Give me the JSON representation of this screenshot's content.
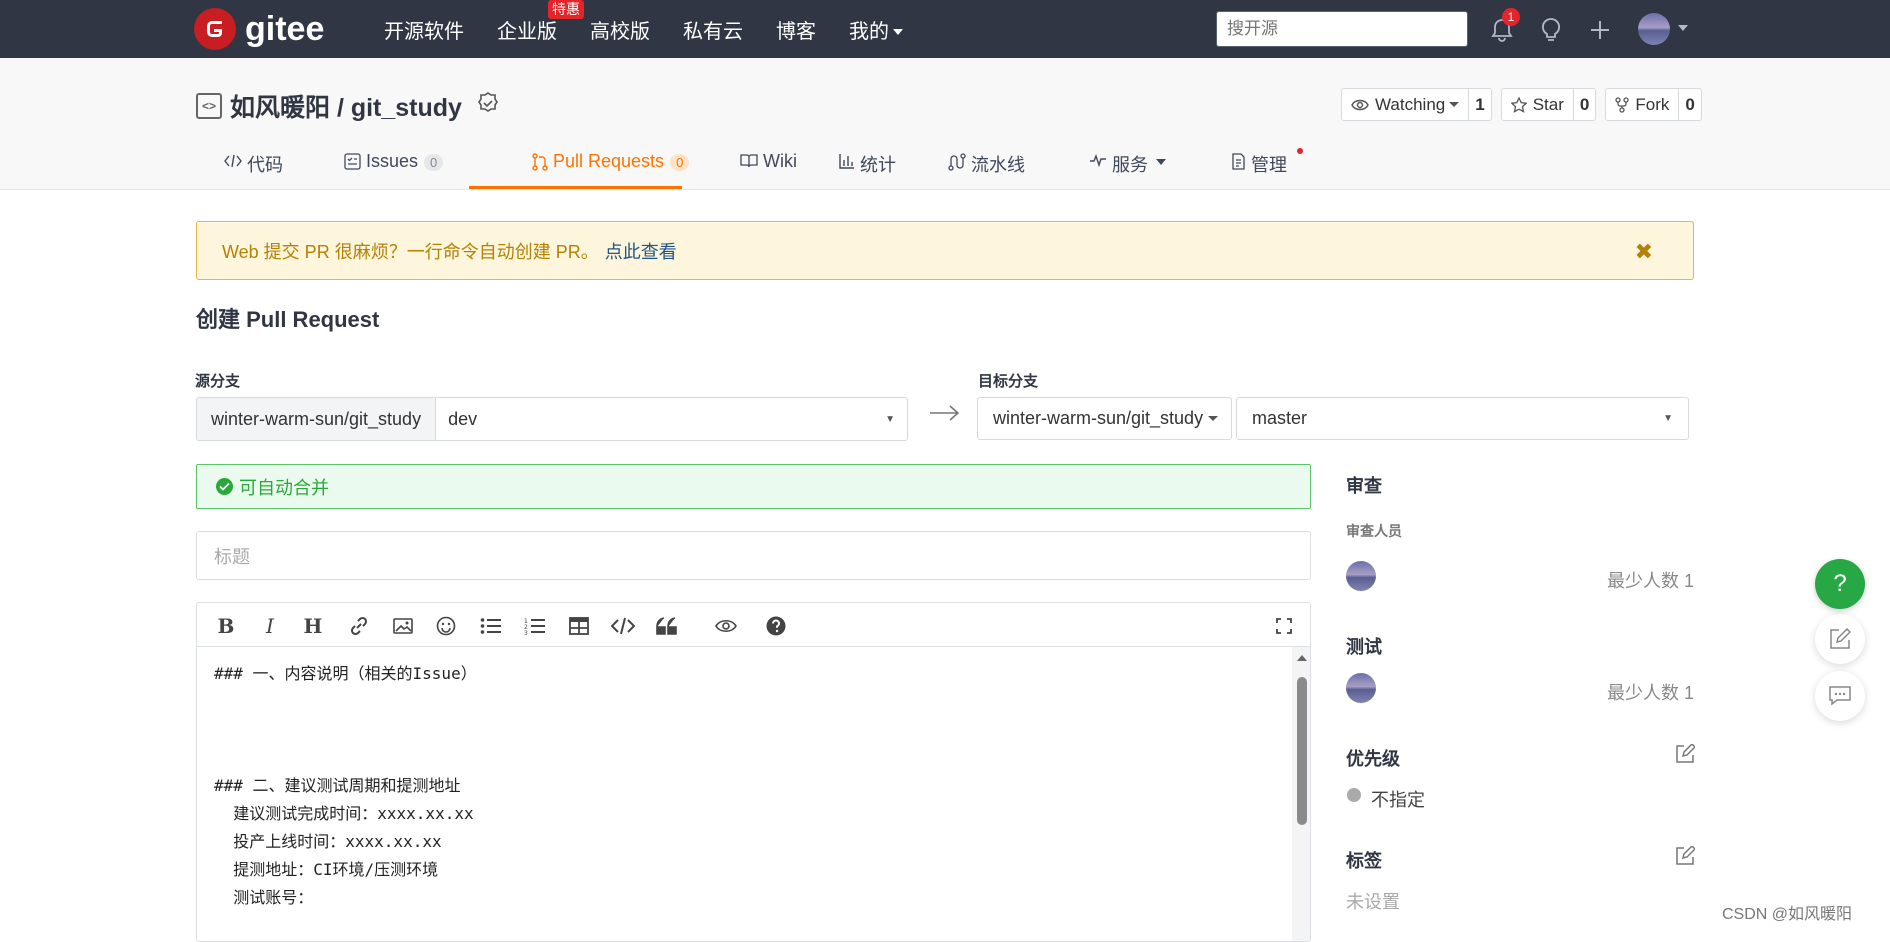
{
  "nav": {
    "logo_text": "gitee",
    "links": [
      "开源软件",
      "企业版",
      "高校版",
      "私有云",
      "博客",
      "我的"
    ],
    "enterprise_badge": "特惠",
    "search_placeholder": "搜开源",
    "notification_count": "1"
  },
  "repo": {
    "title": "如风暖阳 / git_study",
    "watching_label": "Watching",
    "watching_count": "1",
    "star_label": "Star",
    "star_count": "0",
    "fork_label": "Fork",
    "fork_count": "0"
  },
  "tabs": [
    {
      "label": "代码"
    },
    {
      "label": "Issues",
      "count": "0"
    },
    {
      "label": "Pull Requests",
      "count": "0"
    },
    {
      "label": "Wiki"
    },
    {
      "label": "统计"
    },
    {
      "label": "流水线"
    },
    {
      "label": "服务"
    },
    {
      "label": "管理"
    }
  ],
  "notice": {
    "text": "Web 提交 PR 很麻烦？一行命令自动创建 PR。",
    "link": "点此查看"
  },
  "page_title": "创建 Pull Request",
  "source": {
    "label": "源分支",
    "repo": "winter-warm-sun/git_study",
    "branch": "dev"
  },
  "target": {
    "label": "目标分支",
    "repo": "winter-warm-sun/git_study",
    "branch": "master"
  },
  "merge_status": "可自动合并",
  "title_placeholder": "标题",
  "editor": {
    "content": "### 一、内容说明（相关的Issue）\n\n\n\n### 二、建议测试周期和提测地址\n  建议测试完成时间：xxxx.xx.xx\n  投产上线时间：xxxx.xx.xx\n  提测地址：CI环境/压测环境\n  测试账号："
  },
  "sidebar": {
    "review_heading": "审查",
    "reviewers_label": "审查人员",
    "review_min": "最少人数 1",
    "test_heading": "测试",
    "test_min": "最少人数 1",
    "priority_heading": "优先级",
    "priority_value": "不指定",
    "tags_heading": "标签",
    "tags_value": "未设置"
  },
  "fab": {
    "help": "?"
  },
  "watermark": "CSDN @如风暖阳",
  "colors": {
    "nav_bg": "#303643",
    "accent": "#fe7300",
    "brand": "#c71d23",
    "success": "#29a93a"
  }
}
